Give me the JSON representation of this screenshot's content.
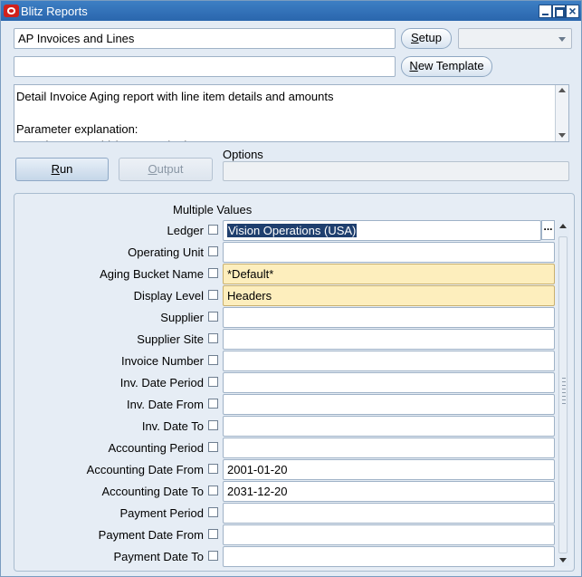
{
  "window": {
    "title": "Blitz Reports"
  },
  "header": {
    "report_name": "AP Invoices and Lines",
    "template_value": "",
    "setup_label": "Setup",
    "setup_mnemonic": "S",
    "setup_rest": "etup",
    "new_template_label": "New Template",
    "new_template_mnemonic": "N",
    "new_template_rest": "ew Template",
    "combo_value": ""
  },
  "description": {
    "text": "Detail Invoice Aging report with line item details and amounts\n\nParameter explanation:\n- Invoices on Hold (LOV: Yes/No)"
  },
  "actions": {
    "run_label": "Run",
    "run_mnemonic": "R",
    "run_rest": "un",
    "output_label": "Output",
    "output_mnemonic": "O",
    "output_rest": "utput",
    "options_label": "Options",
    "options_value": ""
  },
  "parameters": {
    "multiple_values_label": "Multiple Values",
    "rows": [
      {
        "label": "Ledger",
        "value": "Vision Operations (USA)",
        "style": "selected"
      },
      {
        "label": "Operating Unit",
        "value": "",
        "style": "normal"
      },
      {
        "label": "Aging Bucket Name",
        "value": "*Default*",
        "style": "required"
      },
      {
        "label": "Display Level",
        "value": "Headers",
        "style": "required"
      },
      {
        "label": "Supplier",
        "value": "",
        "style": "normal"
      },
      {
        "label": "Supplier Site",
        "value": "",
        "style": "normal"
      },
      {
        "label": "Invoice Number",
        "value": "",
        "style": "normal"
      },
      {
        "label": "Inv. Date Period",
        "value": "",
        "style": "normal"
      },
      {
        "label": "Inv. Date From",
        "value": "",
        "style": "normal"
      },
      {
        "label": "Inv. Date To",
        "value": "",
        "style": "normal"
      },
      {
        "label": "Accounting Period",
        "value": "",
        "style": "normal"
      },
      {
        "label": "Accounting Date From",
        "value": "2001-01-20",
        "style": "normal"
      },
      {
        "label": "Accounting Date To",
        "value": "2031-12-20",
        "style": "normal"
      },
      {
        "label": "Payment Period",
        "value": "",
        "style": "normal"
      },
      {
        "label": "Payment Date From",
        "value": "",
        "style": "normal"
      },
      {
        "label": "Payment Date To",
        "value": "",
        "style": "normal"
      }
    ],
    "lov_button": "..."
  },
  "colors": {
    "titlebar": "#2a66ad",
    "required_field": "#fdeebd",
    "selection": "#1f3f6e"
  }
}
